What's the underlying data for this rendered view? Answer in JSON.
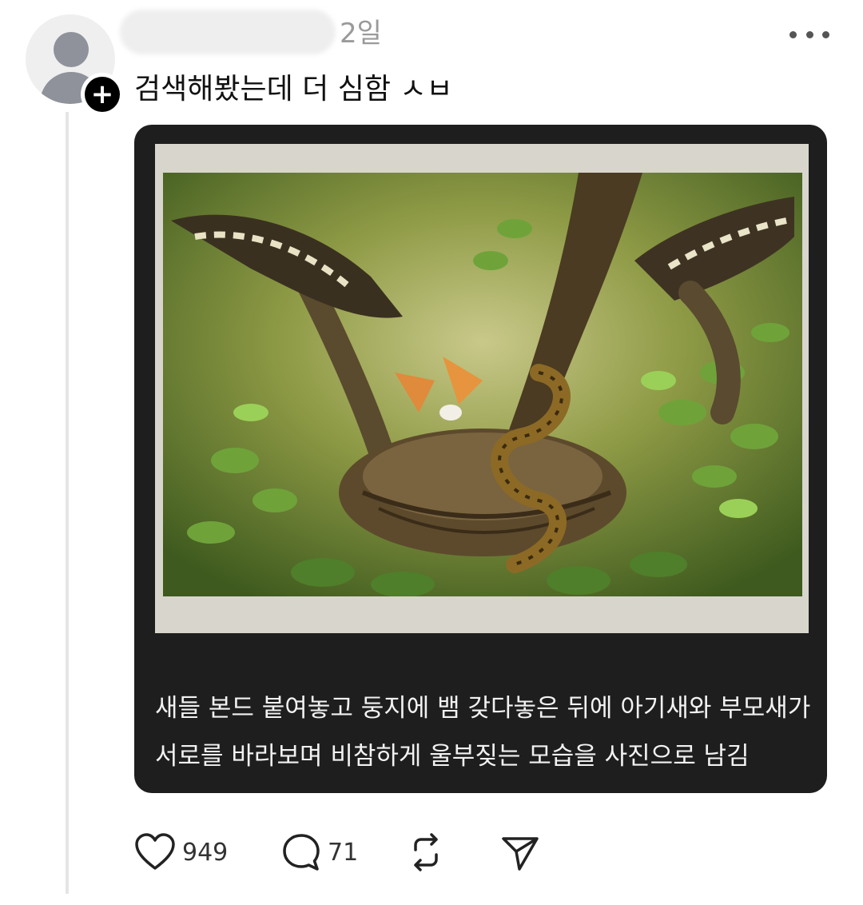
{
  "post": {
    "timestamp": "2일",
    "text": "검색해봤는데 더 심함 ㅅㅂ",
    "follow_badge": "+",
    "image_caption": {
      "line1": "새들 본드 붙여놓고 둥지에 뱀 갖다놓은 뒤에 아기새와 부모새가",
      "line2": "서로를 바라보며 비참하게 울부짖는 모습을 사진으로 남김"
    }
  },
  "actions": {
    "likes": "949",
    "comments": "71"
  },
  "icons": {
    "like": "heart-icon",
    "comment": "comment-bubble-icon",
    "repost": "repost-icon",
    "share": "send-icon",
    "more": "more-options-icon"
  }
}
